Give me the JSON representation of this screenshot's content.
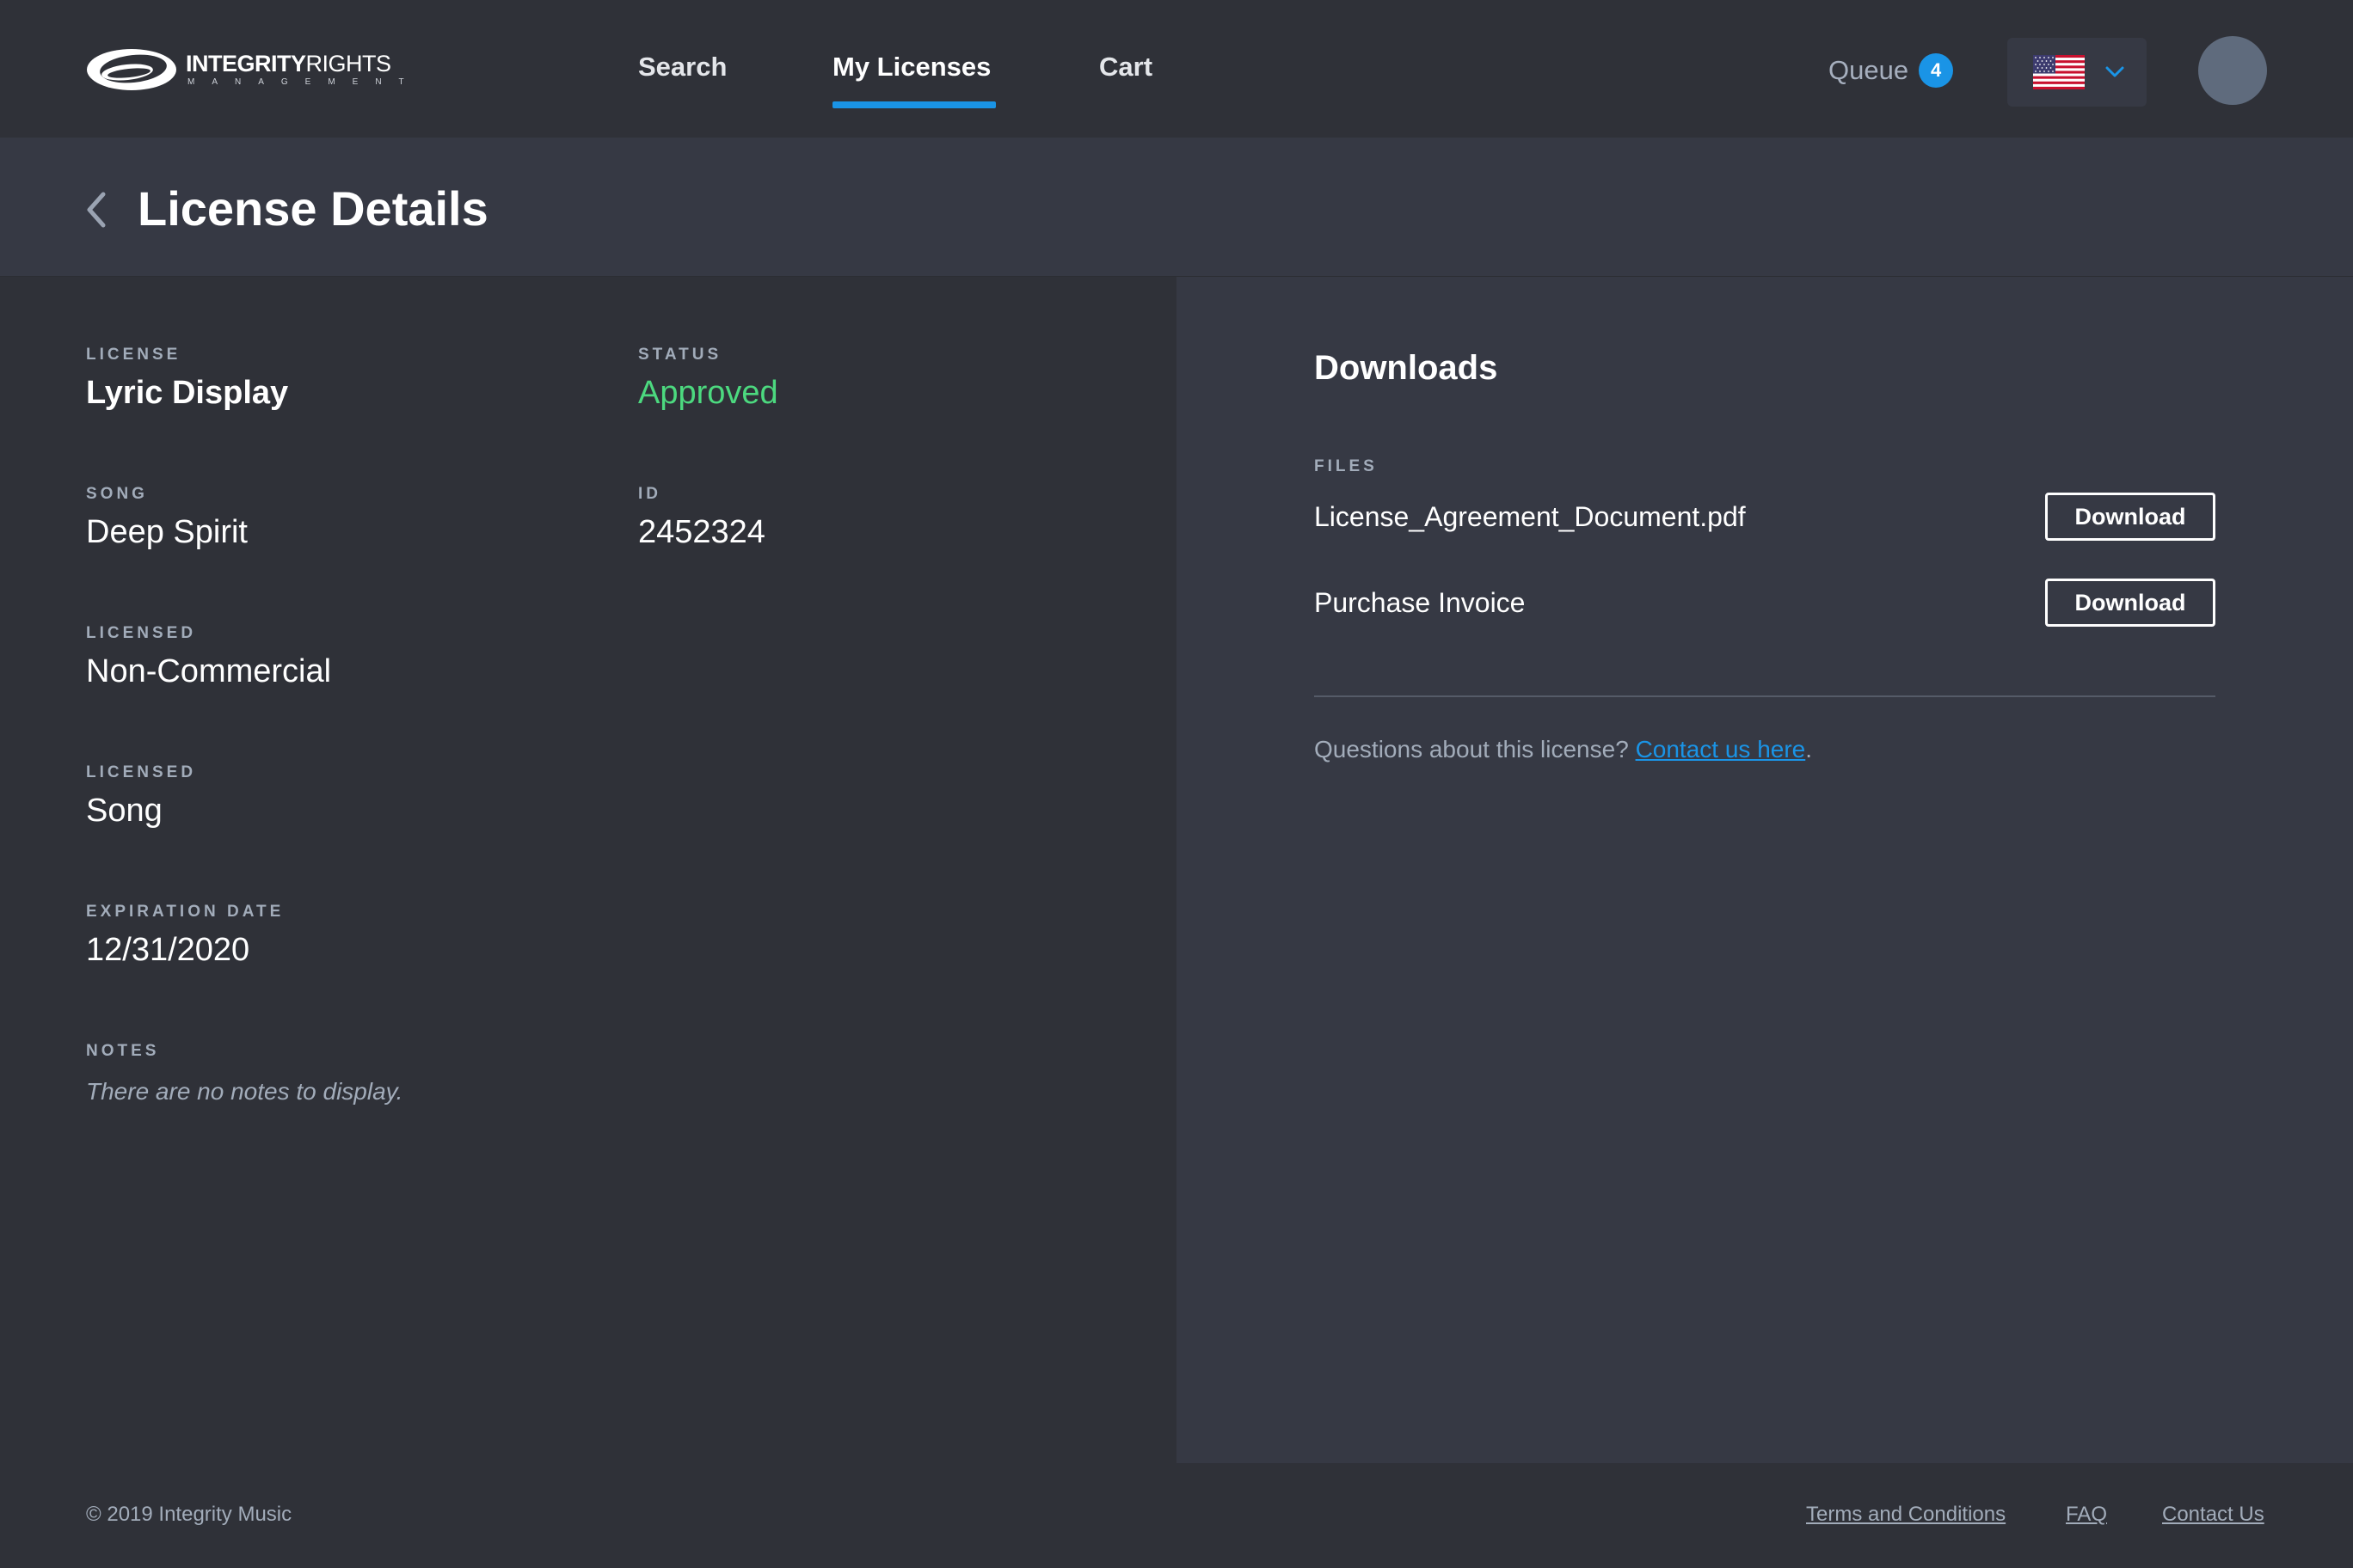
{
  "brand": {
    "name_bold": "INTEGRITY",
    "name_regular": "RIGHTS",
    "sub": "MANAGEMENT"
  },
  "nav": {
    "search": "Search",
    "my_licenses": "My Licenses",
    "cart": "Cart",
    "active": "My Licenses"
  },
  "queue": {
    "label": "Queue",
    "count": "4"
  },
  "language": {
    "flag_icon": "us-flag-icon",
    "selected": "US"
  },
  "page": {
    "title": "License Details"
  },
  "details": {
    "license": {
      "label": "LICENSE",
      "value": "Lyric Display"
    },
    "status": {
      "label": "STATUS",
      "value": "Approved"
    },
    "song": {
      "label": "SONG",
      "value": "Deep Spirit"
    },
    "id": {
      "label": "ID",
      "value": "2452324"
    },
    "licensed_use": {
      "label": "LICENSED",
      "value": "Non-Commercial"
    },
    "licensed_type": {
      "label": "LICENSED",
      "value": "Song"
    },
    "expiration": {
      "label": "EXPIRATION DATE",
      "value": "12/31/2020"
    },
    "notes": {
      "label": "NOTES",
      "value": "There are no notes to display."
    }
  },
  "downloads": {
    "title": "Downloads",
    "files_label": "FILES",
    "files": [
      {
        "name": "License_Agreement_Document.pdf",
        "button": "Download"
      },
      {
        "name": "Purchase Invoice",
        "button": "Download"
      }
    ],
    "question_text": "Questions about this license? ",
    "contact_link": "Contact us here",
    "question_end": "."
  },
  "footer": {
    "copyright": "© 2019 Integrity Music",
    "terms": "Terms and Conditions",
    "faq": "FAQ",
    "contact": "Contact Us"
  },
  "colors": {
    "accent": "#1a94e6",
    "status_approved": "#4cd97f",
    "bg_dark": "#2f3138",
    "bg_panel": "#363944"
  }
}
